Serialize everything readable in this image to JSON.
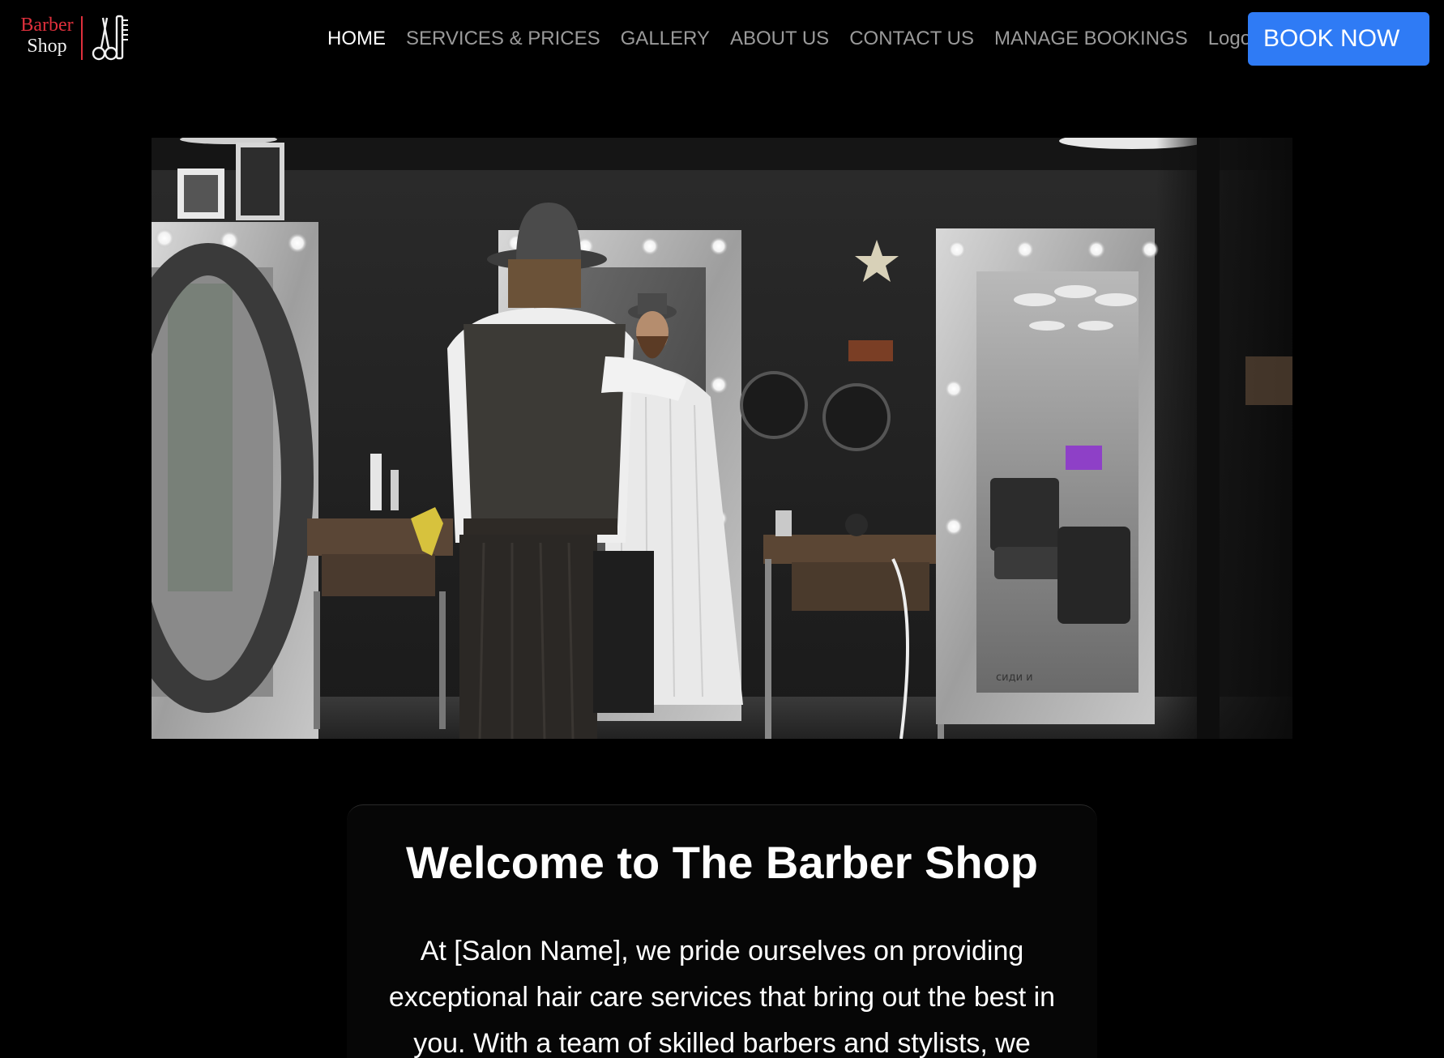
{
  "brand": {
    "line1": "Barber",
    "line2": "Shop"
  },
  "nav": {
    "items": [
      {
        "label": "HOME",
        "active": true
      },
      {
        "label": "SERVICES & PRICES",
        "active": false
      },
      {
        "label": "GALLERY",
        "active": false
      },
      {
        "label": "ABOUT US",
        "active": false
      },
      {
        "label": "CONTACT US",
        "active": false
      },
      {
        "label": "MANAGE BOOKINGS",
        "active": false
      },
      {
        "label": "Logout",
        "active": false
      }
    ],
    "cta": "BOOK NOW"
  },
  "hero": {
    "mirror_label": "сиди и"
  },
  "welcome": {
    "title": "Welcome to The Barber Shop",
    "body": "At [Salon Name], we pride ourselves on providing exceptional hair care services that bring out the best in you. With a team of skilled barbers and stylists, we"
  },
  "colors": {
    "accent": "#2f7bf5",
    "brand_red": "#e0303c",
    "background": "#000000",
    "nav_inactive": "#9a9a9a",
    "nav_active": "#ffffff"
  },
  "icons": [
    "scissors-comb-icon"
  ]
}
